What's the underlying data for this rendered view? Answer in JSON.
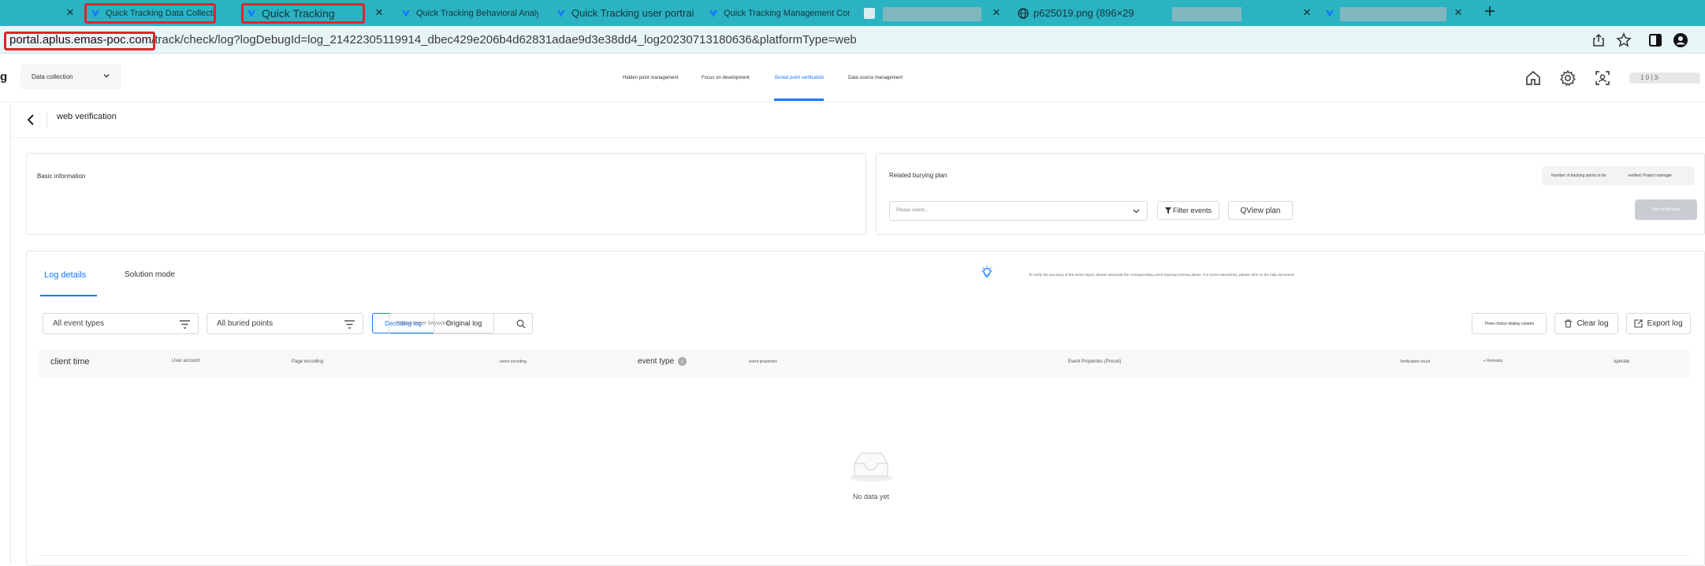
{
  "browser": {
    "tabs": [
      {
        "title": "Quick Tracking Data Collection ×",
        "favicon": "quick-tracking-icon"
      },
      {
        "title": "Quick Tracking",
        "favicon": "quick-tracking-icon"
      },
      {
        "title": "Quick Tracking Behavioral Analysis ×",
        "favicon": "quick-tracking-icon"
      },
      {
        "title": "Quick Tracking user portrait ×",
        "favicon": "quick-tracking-icon"
      },
      {
        "title": "Quick Tracking Management Control ×",
        "favicon": "quick-tracking-icon"
      },
      {
        "title": "",
        "favicon": "blank-page-icon"
      },
      {
        "title": "p625019.png (896×29",
        "favicon": "globe-icon"
      },
      {
        "title": "",
        "favicon": "none"
      },
      {
        "title": "",
        "favicon": "quick-tracking-icon"
      }
    ],
    "new_tab_label": "+",
    "url_host": "portal.aplus.emas-poc.com",
    "url_path": "/track/check/log?logDebugId=log_21422305119914_dbec429e206b4d62831adae9d3e38dd4_log20230713180636&platformType=web",
    "accent_color": "#2bb3c2",
    "highlight_color": "#e0242c"
  },
  "header": {
    "brand_tail": "g",
    "module_select": "Data collection",
    "nav": [
      {
        "label": "Hidden point management"
      },
      {
        "label": "Focus on development"
      },
      {
        "label": "Buried point verification",
        "active": true
      },
      {
        "label": "Data source management"
      }
    ],
    "user_label": "1 0   |   3-",
    "primary_color": "#1677ff"
  },
  "page": {
    "title": "web verification"
  },
  "basic_info": {
    "title": "Basic information"
  },
  "plan": {
    "title": "Related burying plan",
    "select_placeholder": "Please select...",
    "filter_events_label": "Filter events",
    "view_plan_label": "QView plan",
    "stats_tracking_points": "Number of tracking points to be",
    "stats_verified": "verified: Project manager",
    "confirm_label": "Start verification"
  },
  "log": {
    "tabs": [
      {
        "label": "Log details",
        "active": true
      },
      {
        "label": "Solution mode"
      }
    ],
    "hint_text": "To verify the accuracy of the event report, please associate the corresponding event tracking schema above. For more instructions, please click on the help document",
    "event_type_filter": "All event types",
    "buried_points_filter": "All buried points",
    "decoding_log_label": "Decoding log",
    "original_log_label": "Original log",
    "search_placeholder": "Please enter keywords",
    "display_column_label": "Three choice display column",
    "clear_log_label": "Clear log",
    "export_log_label": "Export log",
    "columns": [
      "client time",
      "User account",
      "Page encoding",
      "event encoding",
      "event type",
      "event properties",
      "Event Properties (Preset)",
      "Verification result",
      "+ Remarks",
      "operate"
    ],
    "empty_text": "No data yet"
  }
}
